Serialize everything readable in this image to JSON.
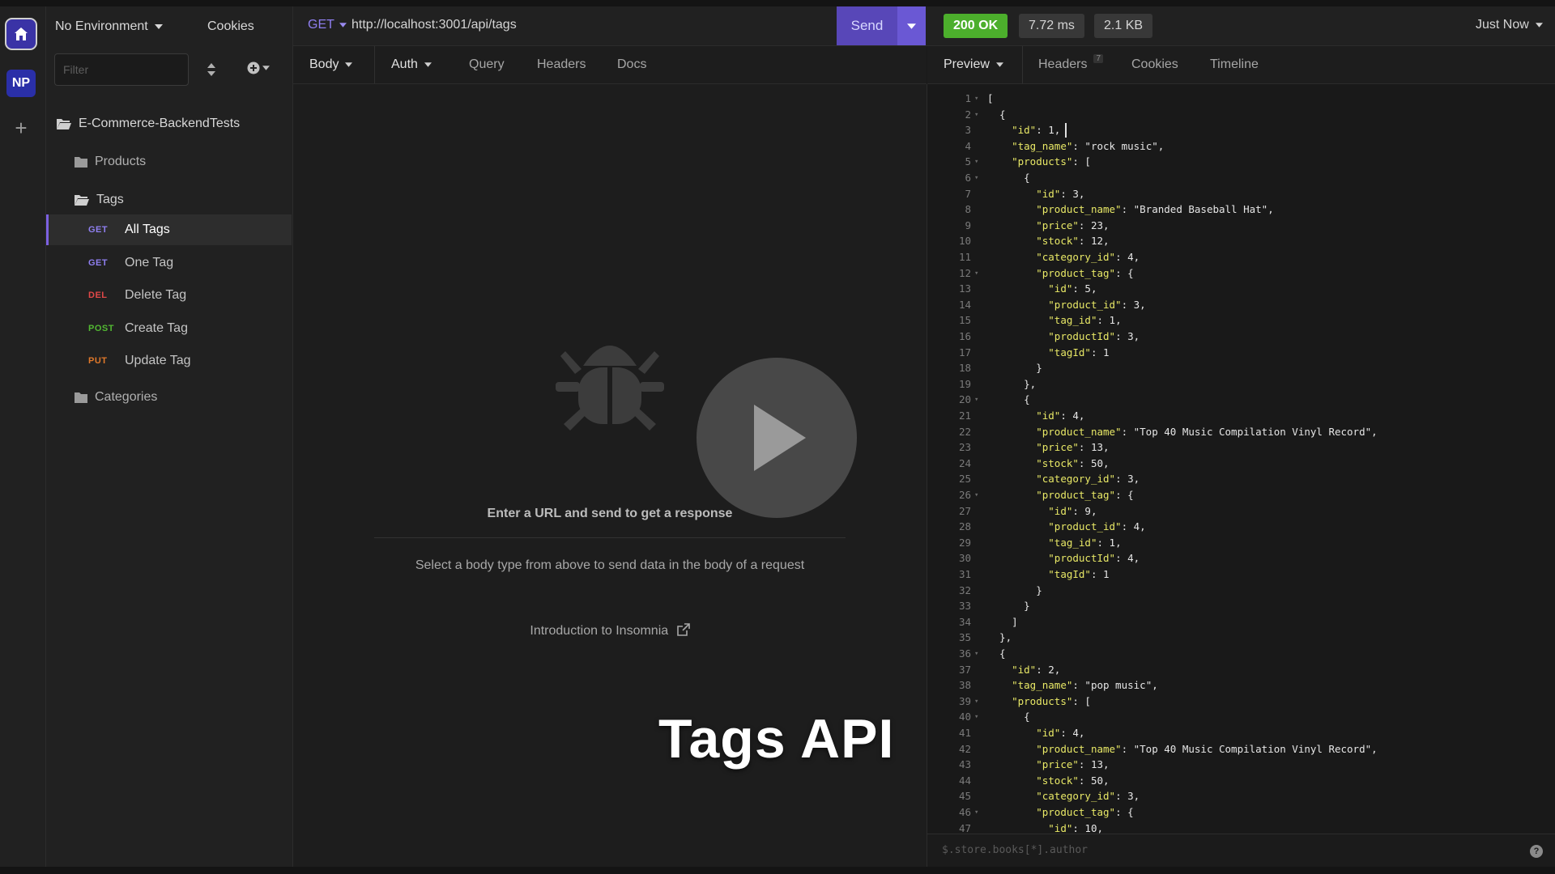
{
  "rail": {
    "np_label": "NP"
  },
  "sidebar": {
    "environment": "No Environment",
    "cookies": "Cookies",
    "filter_placeholder": "Filter",
    "workspace": "E-Commerce-BackendTests",
    "folders": {
      "products": "Products",
      "tags": "Tags",
      "categories": "Categories"
    },
    "requests": [
      {
        "method": "GET",
        "method_color": "#8f7ff0",
        "name": "All Tags",
        "active": true
      },
      {
        "method": "GET",
        "method_color": "#8f7ff0",
        "name": "One Tag"
      },
      {
        "method": "DEL",
        "method_color": "#e04848",
        "name": "Delete Tag"
      },
      {
        "method": "POST",
        "method_color": "#52b832",
        "name": "Create Tag"
      },
      {
        "method": "PUT",
        "method_color": "#e0782a",
        "name": "Update Tag"
      }
    ]
  },
  "urlbar": {
    "method": "GET",
    "url": "http://localhost:3001/api/tags",
    "send": "Send"
  },
  "response_meta": {
    "status": "200 OK",
    "time": "7.72 ms",
    "size": "2.1 KB",
    "history": "Just Now"
  },
  "request_tabs": {
    "body": "Body",
    "auth": "Auth",
    "query": "Query",
    "headers": "Headers",
    "docs": "Docs"
  },
  "request_empty": {
    "title": "Enter a URL and send to get a response",
    "hint": "Select a body type from above to send data in the body of a request",
    "intro": "Introduction to Insomnia"
  },
  "overlay": {
    "title": "Tags API"
  },
  "response_tabs": {
    "preview": "Preview",
    "headers": "Headers",
    "headers_count": "7",
    "cookies": "Cookies",
    "timeline": "Timeline"
  },
  "response_filter_placeholder": "$.store.books[*].author",
  "response_lines": [
    "[",
    "  {",
    "    \"id\": 1,",
    "    \"tag_name\": \"rock music\",",
    "    \"products\": [",
    "      {",
    "        \"id\": 3,",
    "        \"product_name\": \"Branded Baseball Hat\",",
    "        \"price\": 23,",
    "        \"stock\": 12,",
    "        \"category_id\": 4,",
    "        \"product_tag\": {",
    "          \"id\": 5,",
    "          \"product_id\": 3,",
    "          \"tag_id\": 1,",
    "          \"productId\": 3,",
    "          \"tagId\": 1",
    "        }",
    "      },",
    "      {",
    "        \"id\": 4,",
    "        \"product_name\": \"Top 40 Music Compilation Vinyl Record\",",
    "        \"price\": 13,",
    "        \"stock\": 50,",
    "        \"category_id\": 3,",
    "        \"product_tag\": {",
    "          \"id\": 9,",
    "          \"product_id\": 4,",
    "          \"tag_id\": 1,",
    "          \"productId\": 4,",
    "          \"tagId\": 1",
    "        }",
    "      }",
    "    ]",
    "  },",
    "  {",
    "    \"id\": 2,",
    "    \"tag_name\": \"pop music\",",
    "    \"products\": [",
    "      {",
    "        \"id\": 4,",
    "        \"product_name\": \"Top 40 Music Compilation Vinyl Record\",",
    "        \"price\": 13,",
    "        \"stock\": 50,",
    "        \"category_id\": 3,",
    "        \"product_tag\": {",
    "          \"id\": 10,"
  ]
}
